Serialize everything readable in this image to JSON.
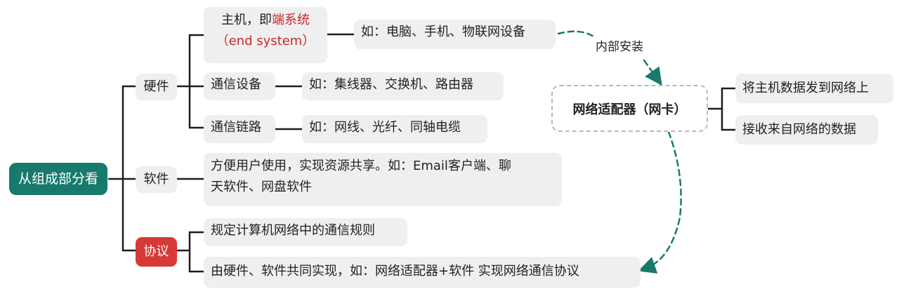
{
  "root": {
    "label": "从组成部分看"
  },
  "hardware": {
    "label": "硬件",
    "host": {
      "prefix": "主机，即",
      "highlight": "端系统",
      "subtitle": "（end system）",
      "example": "如：电脑、手机、物联网设备"
    },
    "device": {
      "label": "通信设备",
      "example": "如：集线器、交换机、路由器"
    },
    "link": {
      "label": "通信链路",
      "example": "如：网线、光纤、同轴电缆"
    }
  },
  "software": {
    "label": "软件",
    "desc_line1": "方便用户使用，实现资源共享。如：Email客户端、聊",
    "desc_line2": "天软件、网盘软件"
  },
  "protocol": {
    "label": "协议",
    "rule": "规定计算机网络中的通信规则",
    "impl": "由硬件、软件共同实现，如：网络适配器+软件 实现网络通信协议"
  },
  "adapter": {
    "label": "网络适配器（网卡）",
    "install_label": "内部安装",
    "functions": [
      "将主机数据发到网络上",
      "接收来自网络的数据"
    ]
  },
  "colors": {
    "root_bg": "#177a6c",
    "protocol_bg": "#d63a37",
    "highlight_text": "#c8282c",
    "node_bg": "#efefef",
    "arrow": "#177a6c"
  }
}
